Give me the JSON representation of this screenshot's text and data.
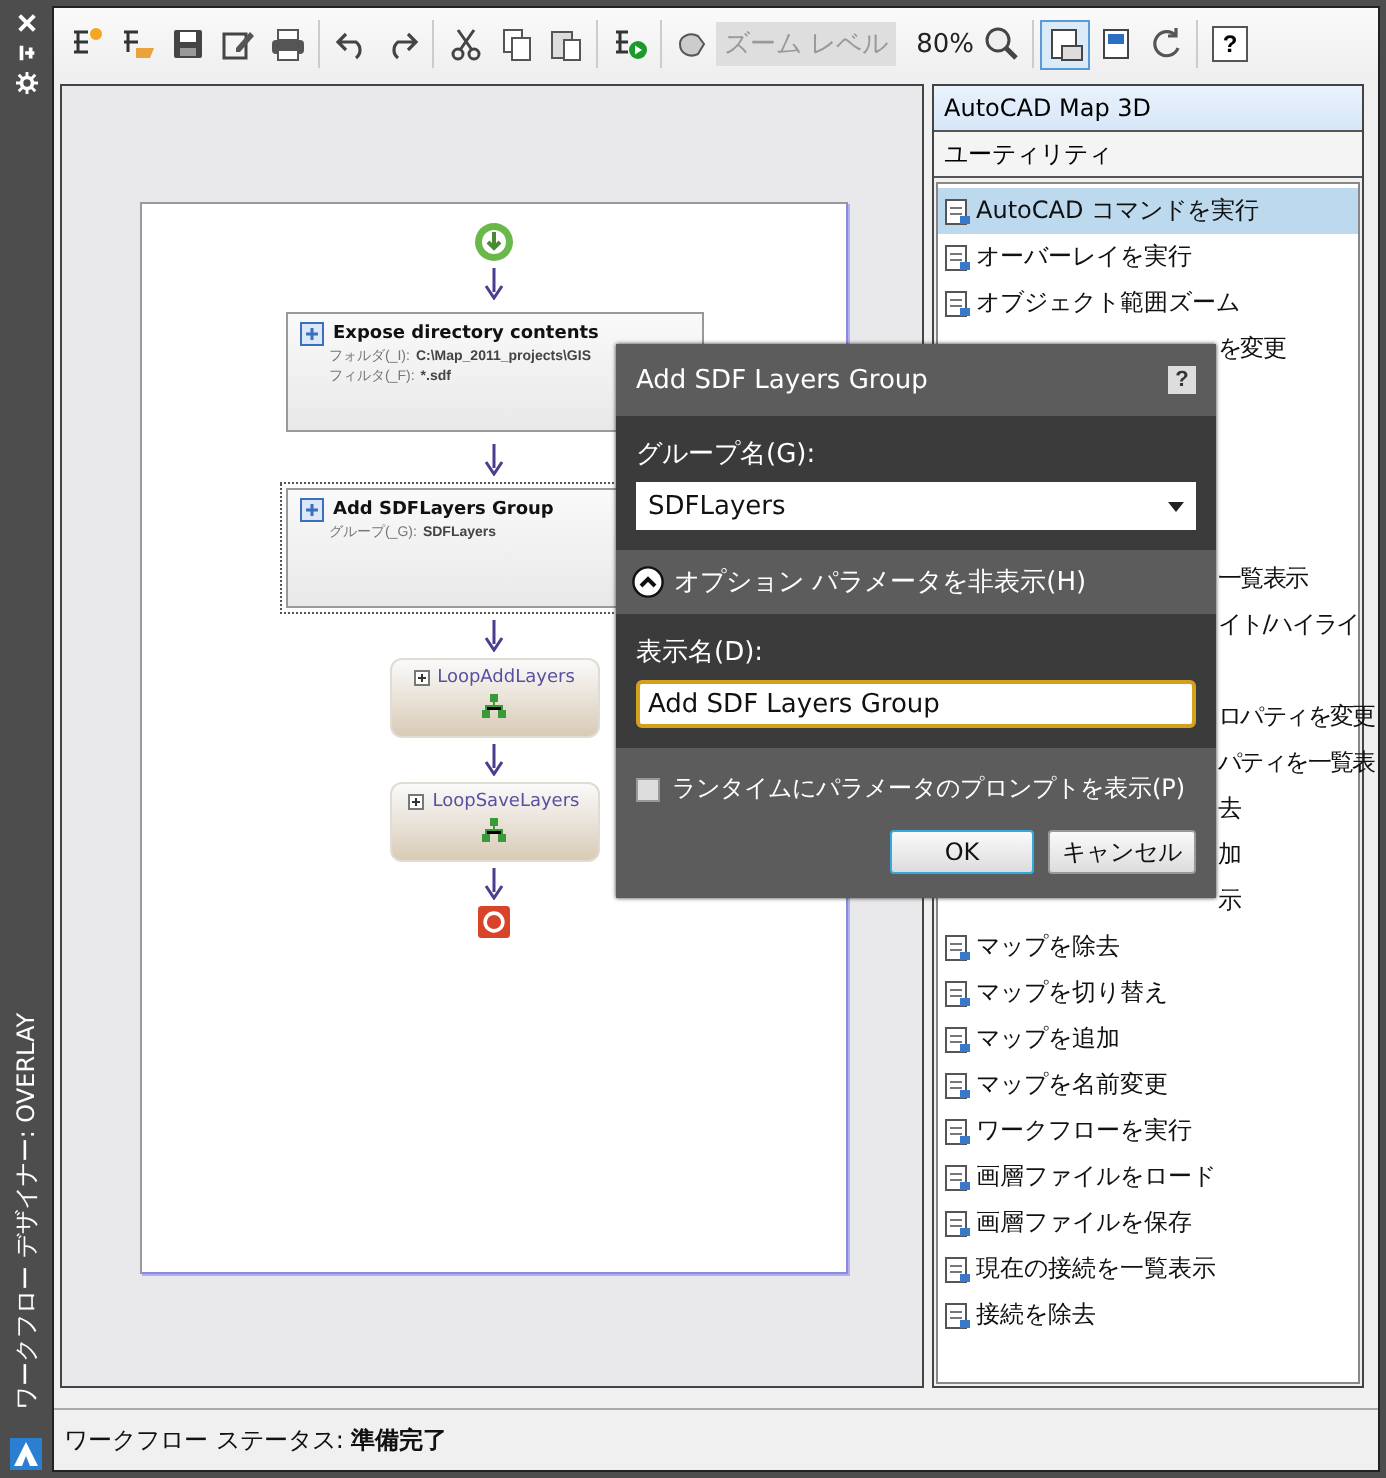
{
  "sidebar": {
    "title": "ワークフロー デザイナー: OVERLAY"
  },
  "toolbar": {
    "groups": [
      [
        {
          "kind": "new"
        },
        {
          "kind": "open"
        },
        {
          "kind": "save"
        },
        {
          "kind": "edit"
        },
        {
          "kind": "print"
        }
      ],
      [
        {
          "kind": "undo"
        },
        {
          "kind": "redo"
        }
      ],
      [
        {
          "kind": "cut"
        },
        {
          "kind": "copy"
        },
        {
          "kind": "paste"
        }
      ],
      [
        {
          "kind": "run"
        }
      ]
    ],
    "zoom_label": "ズーム レベル",
    "zoom_value": "80%",
    "view_buttons": [
      {
        "kind": "canvas",
        "selected": true
      },
      {
        "kind": "panel",
        "selected": false
      },
      {
        "kind": "refresh",
        "selected": false
      }
    ],
    "help": "?"
  },
  "workflow": {
    "nodes": [
      {
        "kind": "start"
      },
      {
        "kind": "activity",
        "title": "Expose directory contents",
        "selected": false,
        "params": [
          {
            "label": "フォルダ(_I):",
            "value": "C:\\Map_2011_projects\\GIS"
          },
          {
            "label": "フィルタ(_F):",
            "value": "*.sdf"
          }
        ]
      },
      {
        "kind": "activity",
        "title": "Add SDFLayers Group",
        "selected": true,
        "params": [
          {
            "label": "グループ(_G):",
            "value": "SDFLayers"
          }
        ]
      },
      {
        "kind": "loop",
        "title": "LoopAddLayers"
      },
      {
        "kind": "loop",
        "title": "LoopSaveLayers"
      },
      {
        "kind": "end"
      }
    ]
  },
  "palette": {
    "categories": [
      {
        "label": "AutoCAD Map 3D",
        "selected": true
      },
      {
        "label": "ユーティリティ",
        "selected": false
      }
    ],
    "items": [
      {
        "kind": "full",
        "label": "AutoCAD コマンドを実行",
        "selected": true
      },
      {
        "kind": "full",
        "label": "オーバーレイを実行",
        "selected": false
      },
      {
        "kind": "full",
        "label": "オブジェクト範囲ズーム",
        "selected": false
      },
      {
        "kind": "partial",
        "label": "を変更",
        "selected": false
      },
      {
        "kind": "covered"
      },
      {
        "kind": "covered"
      },
      {
        "kind": "covered"
      },
      {
        "kind": "covered"
      },
      {
        "kind": "partial",
        "label": "一覧表示",
        "selected": false
      },
      {
        "kind": "partial",
        "label": "イト/ハイライ",
        "selected": false
      },
      {
        "kind": "covered"
      },
      {
        "kind": "partial",
        "label": "ロパティを変更",
        "selected": false
      },
      {
        "kind": "partial",
        "label": "パティを一覧表",
        "selected": false
      },
      {
        "kind": "partial",
        "label": "去",
        "selected": false
      },
      {
        "kind": "partial",
        "label": "加",
        "selected": false
      },
      {
        "kind": "partial",
        "label": "示",
        "selected": false
      },
      {
        "kind": "full",
        "label": "マップを除去",
        "selected": false
      },
      {
        "kind": "full",
        "label": "マップを切り替え",
        "selected": false
      },
      {
        "kind": "full",
        "label": "マップを追加",
        "selected": false
      },
      {
        "kind": "full",
        "label": "マップを名前変更",
        "selected": false
      },
      {
        "kind": "full",
        "label": "ワークフローを実行",
        "selected": false
      },
      {
        "kind": "full",
        "label": "画層ファイルをロード",
        "selected": false
      },
      {
        "kind": "full",
        "label": "画層ファイルを保存",
        "selected": false
      },
      {
        "kind": "full",
        "label": "現在の接続を一覧表示",
        "selected": false
      },
      {
        "kind": "full",
        "label": "接続を除去",
        "selected": false
      }
    ]
  },
  "dialog": {
    "title": "Add SDF Layers Group",
    "help": "?",
    "group_label": "グループ名(G):",
    "group_value": "SDFLayers",
    "toggle_label": "オプション パラメータを非表示(H)",
    "expanded": true,
    "display_label": "表示名(D):",
    "display_value": "Add SDF Layers Group",
    "prompt_label": "ランタイムにパラメータのプロンプトを表示(P)",
    "prompt_checked": false,
    "buttons": [
      {
        "label": "OK",
        "default": true
      },
      {
        "label": "キャンセル",
        "default": false
      }
    ]
  },
  "status_bar": {
    "text": "ワークフロー ステータス: **準備完了**"
  }
}
